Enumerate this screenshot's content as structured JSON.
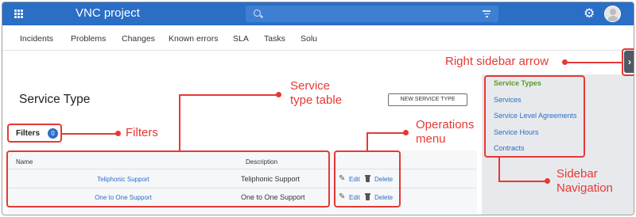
{
  "app": {
    "title": "VNC project"
  },
  "nav_tabs": [
    "Incidents",
    "Problems",
    "Changes",
    "Known errors",
    "SLA",
    "Tasks",
    "Solu"
  ],
  "page": {
    "title": "Service Type",
    "new_button": "NEW SERVICE TYPE"
  },
  "filters": {
    "label": "Filters",
    "count": "0"
  },
  "table": {
    "columns": [
      "Name",
      "Description"
    ],
    "rows": [
      {
        "name": "Teliphonic Support",
        "description": "Teliphonic Support"
      },
      {
        "name": "One to One Support",
        "description": "One to One Support"
      }
    ],
    "ops": {
      "edit": "Edit",
      "delete": "Delete"
    }
  },
  "sidebar": {
    "items": [
      "Service Types",
      "Services",
      "Service Level Agreements",
      "Service Hours",
      "Contracts"
    ],
    "active": "Service Types",
    "arrow": "›"
  },
  "annotations": {
    "right_sidebar_arrow": "Right sidebar arrow",
    "service_type_table": [
      "Service",
      "type table"
    ],
    "filters": "Filters",
    "operations_menu": [
      "Operations",
      "menu"
    ],
    "sidebar_navigation": [
      "Sidebar",
      "Navigation"
    ]
  },
  "colors": {
    "header": "#2a6ec6",
    "annotation": "#e53935",
    "active_sidebar": "#5b9c2c",
    "link": "#2a6ec6"
  },
  "icons": [
    "apps-grid-icon",
    "search-icon",
    "filter-icon",
    "gear-icon",
    "avatar",
    "pencil-icon",
    "trash-icon",
    "chevron-right-icon"
  ]
}
